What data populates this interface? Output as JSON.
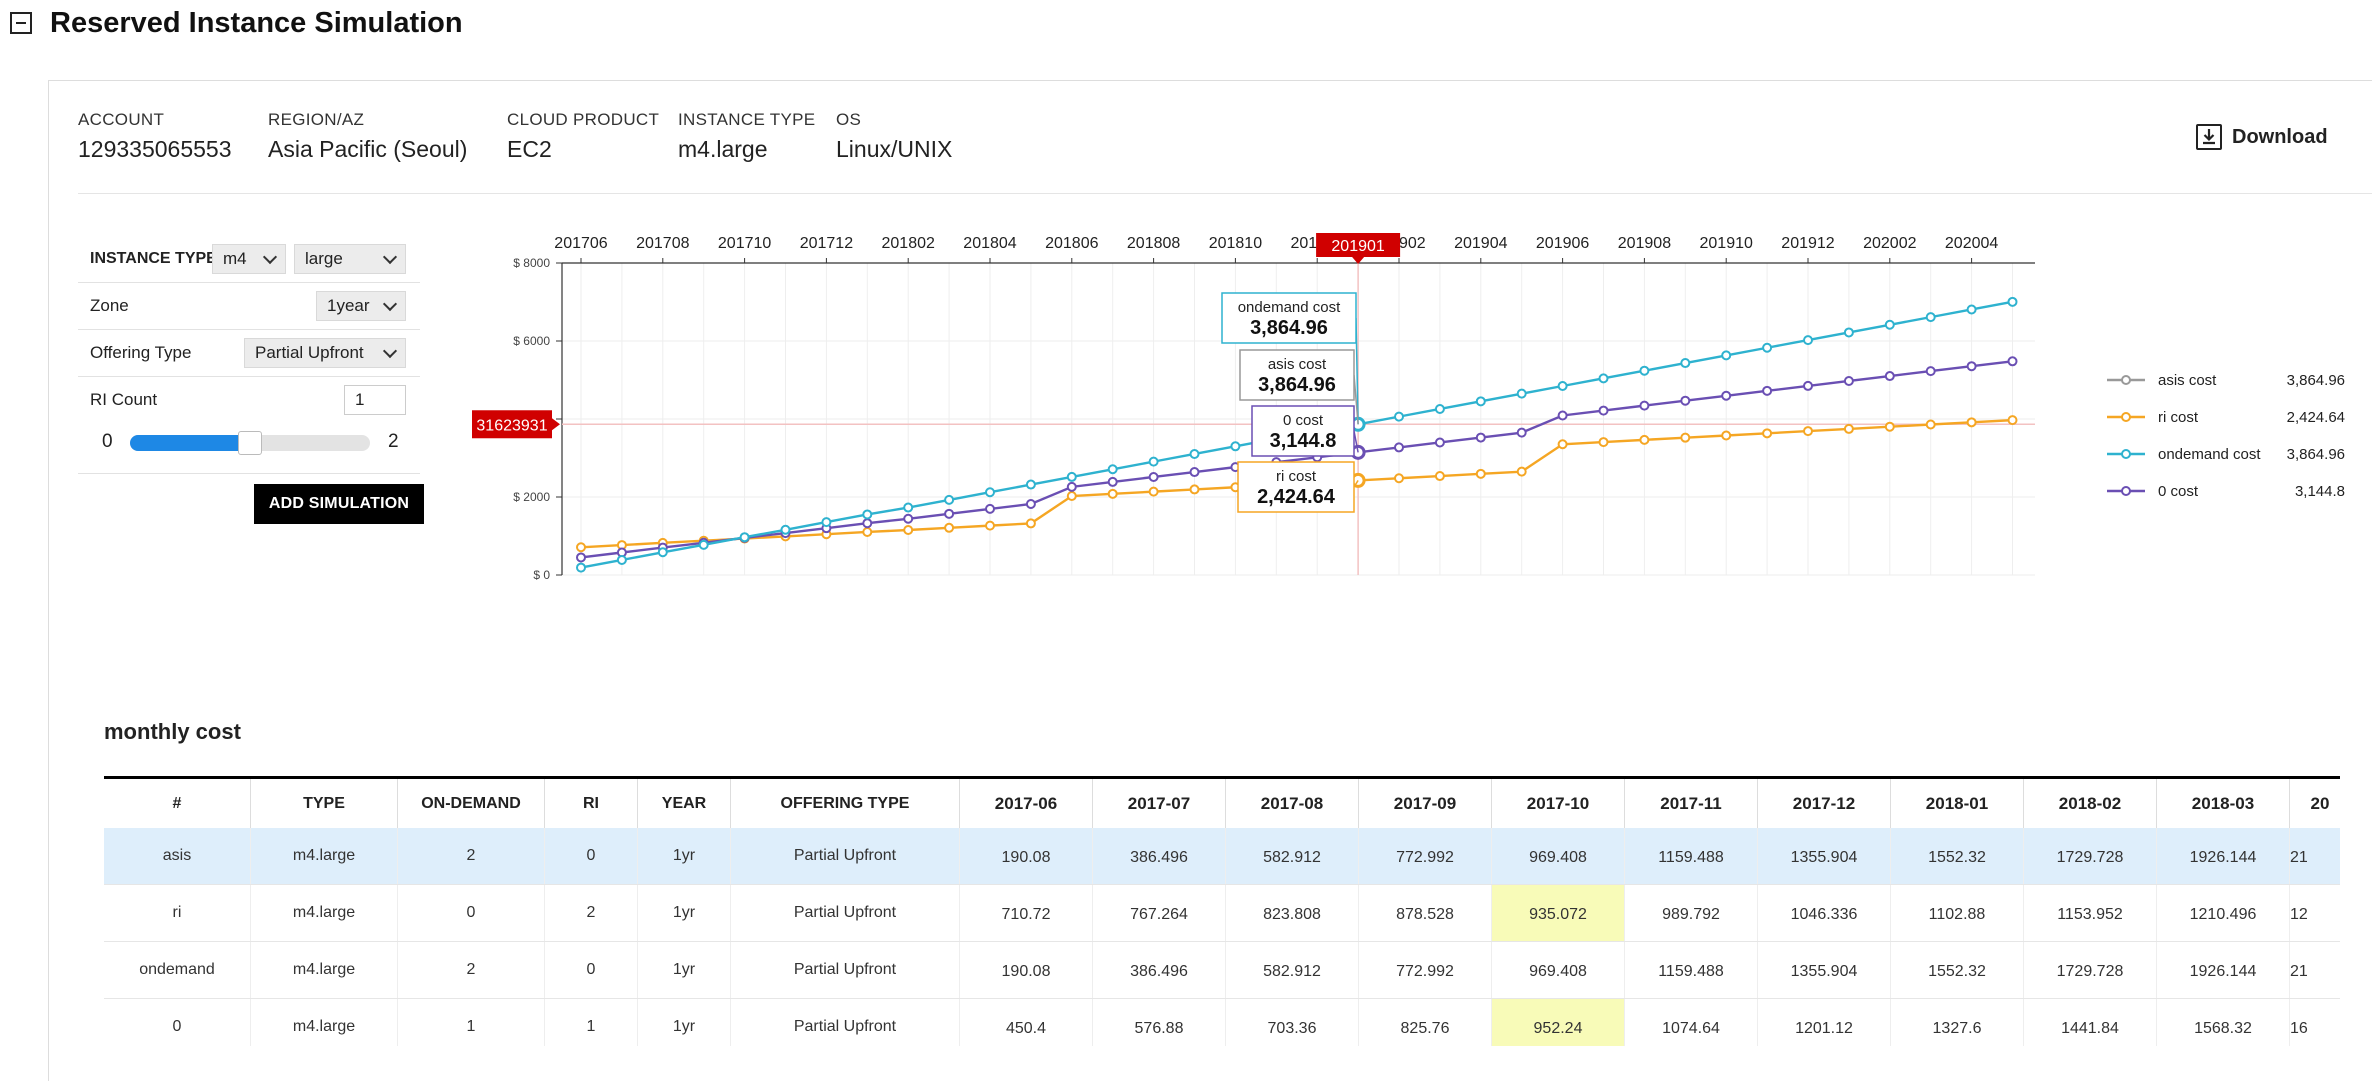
{
  "header": {
    "title": "Reserved Instance Simulation"
  },
  "info": [
    {
      "label": "ACCOUNT",
      "value": "129335065553"
    },
    {
      "label": "REGION/AZ",
      "value": "Asia Pacific (Seoul)"
    },
    {
      "label": "CLOUD PRODUCT",
      "value": "EC2"
    },
    {
      "label": "INSTANCE TYPE",
      "value": "m4.large"
    },
    {
      "label": "OS",
      "value": "Linux/UNIX"
    }
  ],
  "download_label": "Download",
  "controls": {
    "instance_type_label": "INSTANCE TYPE",
    "instance_family": "m4",
    "instance_size": "large",
    "zone_label": "Zone",
    "zone_value": "1year",
    "offering_label": "Offering Type",
    "offering_value": "Partial Upfront",
    "ri_count_label": "RI Count",
    "ri_count_value": "1",
    "slider_min": "0",
    "slider_max": "2",
    "slider_fraction": 0.5,
    "add_button": "ADD SIMULATION"
  },
  "colors": {
    "asis": "#999999",
    "ri": "#f5a623",
    "ondemand": "#2eb2cf",
    "zero": "#6a4fb3",
    "accent": "#1e88e5",
    "marker": "#d00000",
    "highlight": "#f8fbb8",
    "selected_row": "#deeefb"
  },
  "chart_data": {
    "type": "line",
    "x_ticks": [
      "201706",
      "201708",
      "201710",
      "201712",
      "201802",
      "201804",
      "201806",
      "201808",
      "201810",
      "201812",
      "201902",
      "201904",
      "201906",
      "201908",
      "201910",
      "201912",
      "202002",
      "202004"
    ],
    "y_ticks": [
      "$ 0",
      "$ 2000",
      "$ 4000",
      "$ 6000",
      "$ 8000"
    ],
    "ylim": [
      0,
      8000
    ],
    "x_start": "201706",
    "marker_label": "201901",
    "hline_label": "31623931",
    "hline_value": 3864.96,
    "series": [
      {
        "key": "ondemand",
        "name": "ondemand cost",
        "values": [
          190,
          386,
          583,
          773,
          969,
          1159,
          1356,
          1552,
          1730,
          1926,
          2122,
          2319,
          2515,
          2711,
          2907,
          3103,
          3300,
          3496,
          3668,
          3865,
          4061,
          4257,
          4453,
          4650,
          4846,
          5042,
          5238,
          5435,
          5631,
          5827,
          6023,
          6219,
          6416,
          6612,
          6808,
          7004
        ]
      },
      {
        "key": "zero",
        "name": "0 cost",
        "values": [
          450,
          577,
          703,
          826,
          952,
          1075,
          1201,
          1328,
          1442,
          1568,
          1695,
          1821,
          2260,
          2387,
          2513,
          2640,
          2766,
          2893,
          3019,
          3145,
          3271,
          3398,
          3524,
          3650,
          4090,
          4216,
          4343,
          4469,
          4596,
          4722,
          4848,
          4975,
          5101,
          5228,
          5354,
          5480
        ]
      },
      {
        "key": "ri",
        "name": "ri cost",
        "values": [
          711,
          767,
          824,
          879,
          935,
          990,
          1046,
          1103,
          1154,
          1210,
          1266,
          1323,
          2025,
          2081,
          2138,
          2194,
          2250,
          2306,
          2368,
          2425,
          2481,
          2537,
          2594,
          2650,
          3352,
          3408,
          3465,
          3521,
          3577,
          3633,
          3690,
          3746,
          3802,
          3859,
          3915,
          3971
        ]
      }
    ],
    "tooltips": [
      {
        "series": "ondemand cost",
        "value": "3,864.96"
      },
      {
        "series": "asis cost",
        "value": "3,864.96"
      },
      {
        "series": "0 cost",
        "value": "3,144.8"
      },
      {
        "series": "ri cost",
        "value": "2,424.64"
      }
    ],
    "legend": [
      {
        "key": "asis",
        "name": "asis cost",
        "value": "3,864.96"
      },
      {
        "key": "ri",
        "name": "ri cost",
        "value": "2,424.64"
      },
      {
        "key": "ondemand",
        "name": "ondemand cost",
        "value": "3,864.96"
      },
      {
        "key": "zero",
        "name": "0 cost",
        "value": "3,144.8"
      }
    ]
  },
  "monthly": {
    "title": "monthly cost",
    "columns": [
      "#",
      "TYPE",
      "ON-DEMAND",
      "RI",
      "YEAR",
      "OFFERING TYPE",
      "2017-06",
      "2017-07",
      "2017-08",
      "2017-09",
      "2017-10",
      "2017-11",
      "2017-12",
      "2018-01",
      "2018-02",
      "2018-03",
      "20"
    ],
    "rows": [
      {
        "cells": [
          "asis",
          "m4.large",
          "2",
          "0",
          "1yr",
          "Partial Upfront",
          "190.08",
          "386.496",
          "582.912",
          "772.992",
          "969.408",
          "1159.488",
          "1355.904",
          "1552.32",
          "1729.728",
          "1926.144",
          "21"
        ],
        "selected": true,
        "hl": []
      },
      {
        "cells": [
          "ri",
          "m4.large",
          "0",
          "2",
          "1yr",
          "Partial Upfront",
          "710.72",
          "767.264",
          "823.808",
          "878.528",
          "935.072",
          "989.792",
          "1046.336",
          "1102.88",
          "1153.952",
          "1210.496",
          "12"
        ],
        "selected": false,
        "hl": [
          10
        ]
      },
      {
        "cells": [
          "ondemand",
          "m4.large",
          "2",
          "0",
          "1yr",
          "Partial Upfront",
          "190.08",
          "386.496",
          "582.912",
          "772.992",
          "969.408",
          "1159.488",
          "1355.904",
          "1552.32",
          "1729.728",
          "1926.144",
          "21"
        ],
        "selected": false,
        "hl": []
      },
      {
        "cells": [
          "0",
          "m4.large",
          "1",
          "1",
          "1yr",
          "Partial Upfront",
          "450.4",
          "576.88",
          "703.36",
          "825.76",
          "952.24",
          "1074.64",
          "1201.12",
          "1327.6",
          "1441.84",
          "1568.32",
          "16"
        ],
        "selected": false,
        "hl": [
          10
        ]
      }
    ]
  }
}
